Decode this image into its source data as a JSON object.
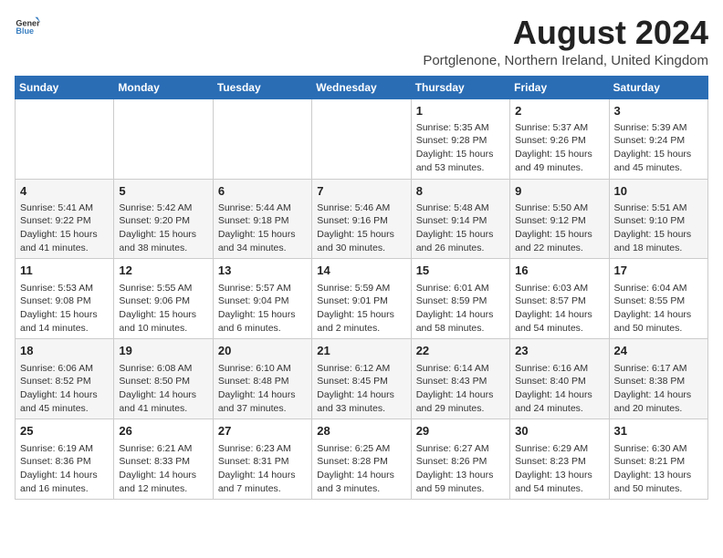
{
  "logo": {
    "text_general": "General",
    "text_blue": "Blue"
  },
  "title": "August 2024",
  "subtitle": "Portglenone, Northern Ireland, United Kingdom",
  "days_of_week": [
    "Sunday",
    "Monday",
    "Tuesday",
    "Wednesday",
    "Thursday",
    "Friday",
    "Saturday"
  ],
  "weeks": [
    [
      {
        "day": "",
        "info": ""
      },
      {
        "day": "",
        "info": ""
      },
      {
        "day": "",
        "info": ""
      },
      {
        "day": "",
        "info": ""
      },
      {
        "day": "1",
        "info": "Sunrise: 5:35 AM\nSunset: 9:28 PM\nDaylight: 15 hours and 53 minutes."
      },
      {
        "day": "2",
        "info": "Sunrise: 5:37 AM\nSunset: 9:26 PM\nDaylight: 15 hours and 49 minutes."
      },
      {
        "day": "3",
        "info": "Sunrise: 5:39 AM\nSunset: 9:24 PM\nDaylight: 15 hours and 45 minutes."
      }
    ],
    [
      {
        "day": "4",
        "info": "Sunrise: 5:41 AM\nSunset: 9:22 PM\nDaylight: 15 hours and 41 minutes."
      },
      {
        "day": "5",
        "info": "Sunrise: 5:42 AM\nSunset: 9:20 PM\nDaylight: 15 hours and 38 minutes."
      },
      {
        "day": "6",
        "info": "Sunrise: 5:44 AM\nSunset: 9:18 PM\nDaylight: 15 hours and 34 minutes."
      },
      {
        "day": "7",
        "info": "Sunrise: 5:46 AM\nSunset: 9:16 PM\nDaylight: 15 hours and 30 minutes."
      },
      {
        "day": "8",
        "info": "Sunrise: 5:48 AM\nSunset: 9:14 PM\nDaylight: 15 hours and 26 minutes."
      },
      {
        "day": "9",
        "info": "Sunrise: 5:50 AM\nSunset: 9:12 PM\nDaylight: 15 hours and 22 minutes."
      },
      {
        "day": "10",
        "info": "Sunrise: 5:51 AM\nSunset: 9:10 PM\nDaylight: 15 hours and 18 minutes."
      }
    ],
    [
      {
        "day": "11",
        "info": "Sunrise: 5:53 AM\nSunset: 9:08 PM\nDaylight: 15 hours and 14 minutes."
      },
      {
        "day": "12",
        "info": "Sunrise: 5:55 AM\nSunset: 9:06 PM\nDaylight: 15 hours and 10 minutes."
      },
      {
        "day": "13",
        "info": "Sunrise: 5:57 AM\nSunset: 9:04 PM\nDaylight: 15 hours and 6 minutes."
      },
      {
        "day": "14",
        "info": "Sunrise: 5:59 AM\nSunset: 9:01 PM\nDaylight: 15 hours and 2 minutes."
      },
      {
        "day": "15",
        "info": "Sunrise: 6:01 AM\nSunset: 8:59 PM\nDaylight: 14 hours and 58 minutes."
      },
      {
        "day": "16",
        "info": "Sunrise: 6:03 AM\nSunset: 8:57 PM\nDaylight: 14 hours and 54 minutes."
      },
      {
        "day": "17",
        "info": "Sunrise: 6:04 AM\nSunset: 8:55 PM\nDaylight: 14 hours and 50 minutes."
      }
    ],
    [
      {
        "day": "18",
        "info": "Sunrise: 6:06 AM\nSunset: 8:52 PM\nDaylight: 14 hours and 45 minutes."
      },
      {
        "day": "19",
        "info": "Sunrise: 6:08 AM\nSunset: 8:50 PM\nDaylight: 14 hours and 41 minutes."
      },
      {
        "day": "20",
        "info": "Sunrise: 6:10 AM\nSunset: 8:48 PM\nDaylight: 14 hours and 37 minutes."
      },
      {
        "day": "21",
        "info": "Sunrise: 6:12 AM\nSunset: 8:45 PM\nDaylight: 14 hours and 33 minutes."
      },
      {
        "day": "22",
        "info": "Sunrise: 6:14 AM\nSunset: 8:43 PM\nDaylight: 14 hours and 29 minutes."
      },
      {
        "day": "23",
        "info": "Sunrise: 6:16 AM\nSunset: 8:40 PM\nDaylight: 14 hours and 24 minutes."
      },
      {
        "day": "24",
        "info": "Sunrise: 6:17 AM\nSunset: 8:38 PM\nDaylight: 14 hours and 20 minutes."
      }
    ],
    [
      {
        "day": "25",
        "info": "Sunrise: 6:19 AM\nSunset: 8:36 PM\nDaylight: 14 hours and 16 minutes."
      },
      {
        "day": "26",
        "info": "Sunrise: 6:21 AM\nSunset: 8:33 PM\nDaylight: 14 hours and 12 minutes."
      },
      {
        "day": "27",
        "info": "Sunrise: 6:23 AM\nSunset: 8:31 PM\nDaylight: 14 hours and 7 minutes."
      },
      {
        "day": "28",
        "info": "Sunrise: 6:25 AM\nSunset: 8:28 PM\nDaylight: 14 hours and 3 minutes."
      },
      {
        "day": "29",
        "info": "Sunrise: 6:27 AM\nSunset: 8:26 PM\nDaylight: 13 hours and 59 minutes."
      },
      {
        "day": "30",
        "info": "Sunrise: 6:29 AM\nSunset: 8:23 PM\nDaylight: 13 hours and 54 minutes."
      },
      {
        "day": "31",
        "info": "Sunrise: 6:30 AM\nSunset: 8:21 PM\nDaylight: 13 hours and 50 minutes."
      }
    ]
  ]
}
